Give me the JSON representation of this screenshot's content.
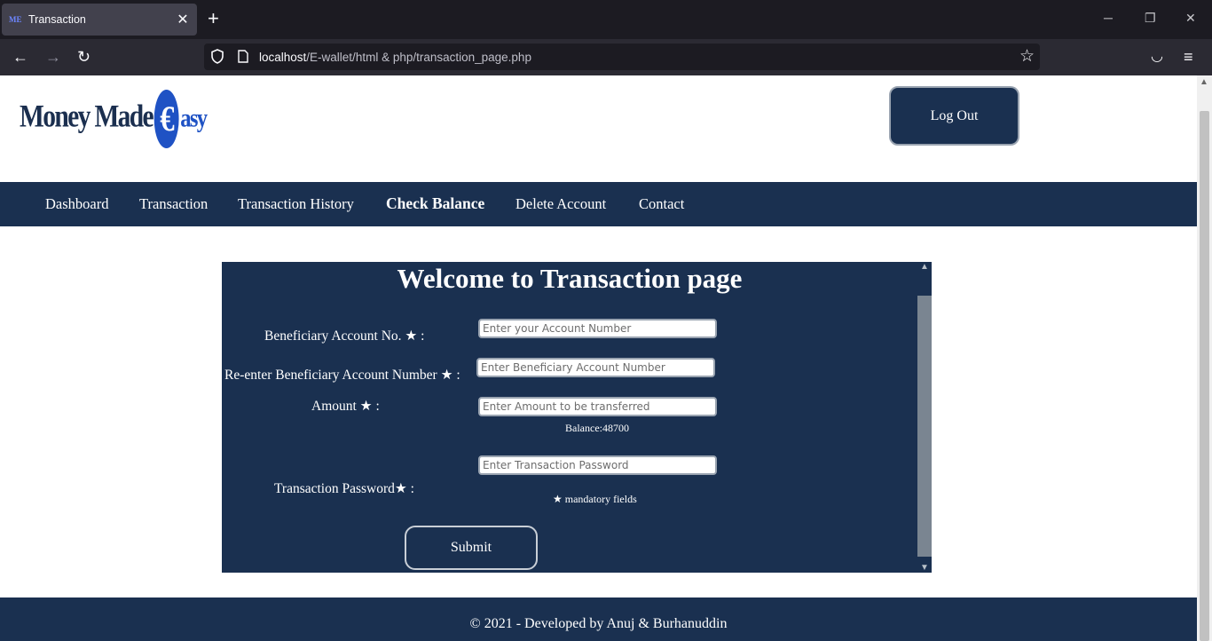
{
  "browser": {
    "tab_title": "Transaction",
    "tab_favicon": "ME",
    "new_tab_icon": "+",
    "url_host": "localhost",
    "url_path": "/E-wallet/html & php/transaction_page.php",
    "window_controls": [
      "minimize",
      "restore",
      "close"
    ]
  },
  "header": {
    "logo_text_left": "Money Made",
    "logo_glyph": "€",
    "logo_text_right": "asy",
    "logout_label": "Log Out"
  },
  "menu": {
    "items": [
      {
        "label": "Dashboard"
      },
      {
        "label": "Transaction"
      },
      {
        "label": "Transaction History"
      },
      {
        "label": "Check Balance"
      },
      {
        "label": "Delete Account"
      },
      {
        "label": "Contact"
      }
    ]
  },
  "form": {
    "title": "Welcome to Transaction page",
    "beneficiary_label": "Beneficiary Account No. ★ :",
    "beneficiary_placeholder": "Enter your Account Number",
    "reenter_label": "Re-enter Beneficiary Account Number ★  :",
    "reenter_placeholder": "Enter Beneficiary Account Number",
    "amount_label": "Amount ★  :",
    "amount_placeholder": "Enter Amount to be transferred",
    "balance_text": "Balance:48700",
    "password_label": "Transaction Password★  :",
    "password_placeholder": "Enter Transaction Password",
    "mandatory_note": "★ mandatory fields",
    "submit_label": "Submit"
  },
  "footer": {
    "text": "© 2021 - Developed by Anuj & Burhanuddin"
  },
  "colors": {
    "navy": "#1a3050",
    "logo_blue": "#1f52c4"
  }
}
